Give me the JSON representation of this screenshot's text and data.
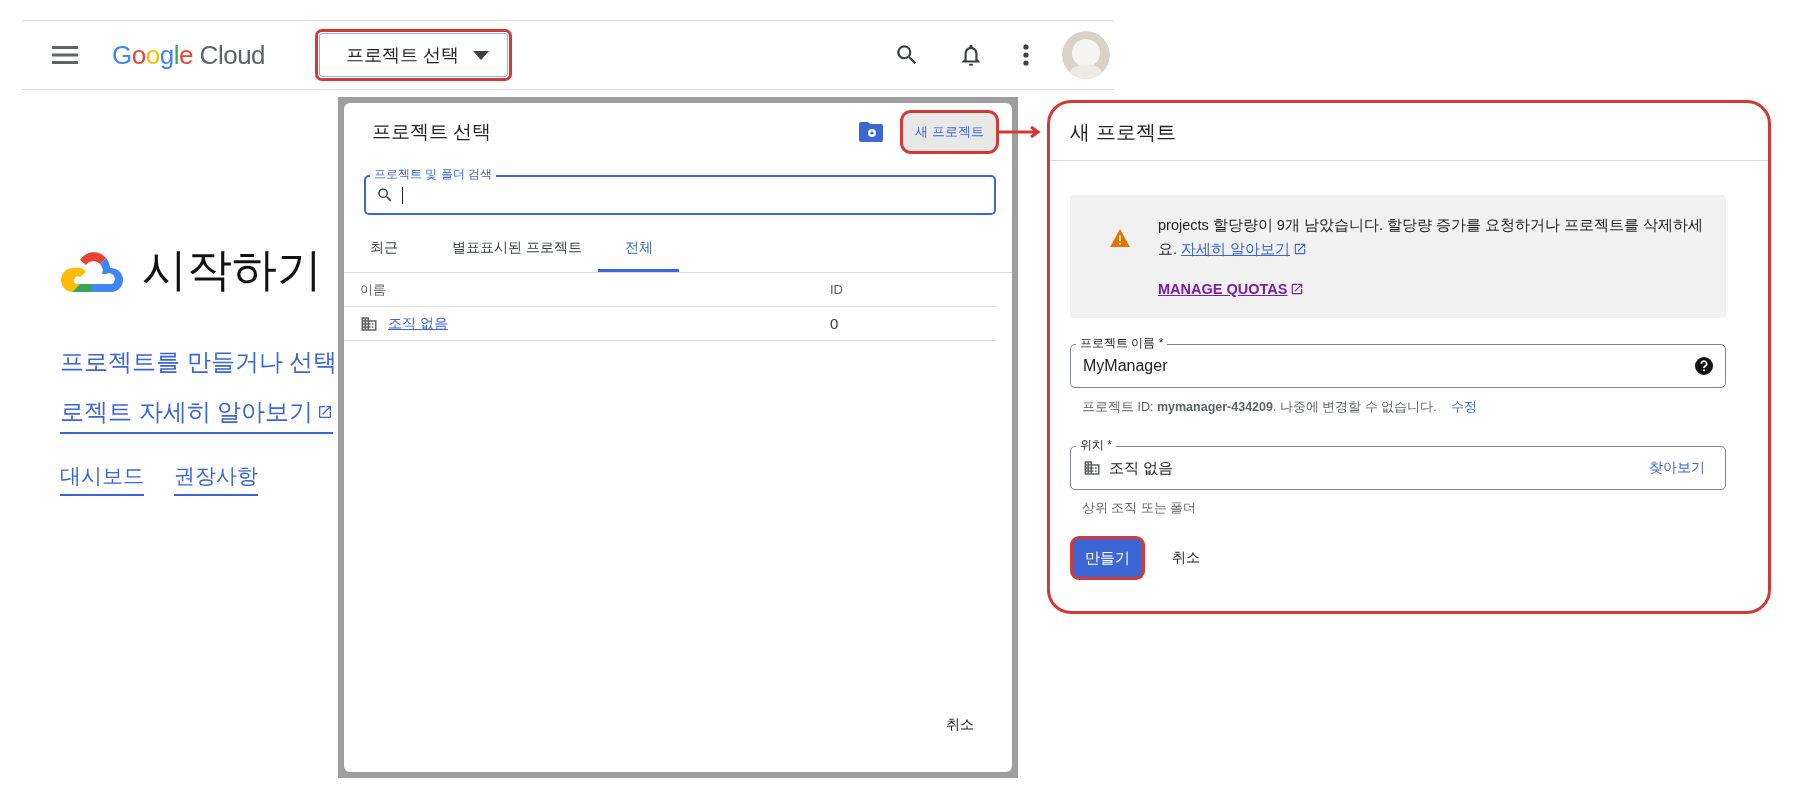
{
  "header": {
    "logo": {
      "brand": "Google",
      "product": "Cloud"
    },
    "project_picker": {
      "label": "프로젝트 선택",
      "highlighted": true
    }
  },
  "page": {
    "title": "시작하기",
    "links": [
      {
        "text": "프로젝트를 만들거나 선택",
        "external": false
      },
      {
        "text": "로젝트 자세히 알아보기",
        "external": true
      }
    ],
    "nav_links": [
      "대시보드",
      "권장사항"
    ]
  },
  "select_dialog": {
    "title": "프로젝트 선택",
    "new_button": {
      "label": "새 프로젝트",
      "highlighted": true
    },
    "search": {
      "label": "프로젝트 및 폴더 검색"
    },
    "tabs": [
      {
        "label": "최근",
        "selected": false
      },
      {
        "label": "별표표시된 프로젝트",
        "selected": false
      },
      {
        "label": "전체",
        "selected": true
      }
    ],
    "columns": [
      "이름",
      "ID"
    ],
    "rows": [
      {
        "name": "조직 없음",
        "id": "0"
      }
    ],
    "cancel": "취소"
  },
  "new_project": {
    "title": "새 프로젝트",
    "highlighted": true,
    "notice": {
      "text": "projects 할당량이 9개 남았습니다. 할당량 증가를 요청하거나 프로젝트를 삭제하세요.",
      "learn_more": "자세히 알아보기",
      "manage": "MANAGE QUOTAS"
    },
    "name_field": {
      "label": "프로젝트 이름 *",
      "value": "MyManager"
    },
    "id_hint": {
      "text": "프로젝트 ID: **mymanager-434209**. 나중에 변경할 수 없습니다.",
      "edit": "수정"
    },
    "location_field": {
      "label": "위치 *",
      "value": "조직 없음",
      "browse": "찾아보기"
    },
    "location_hint": "상위 조직 또는 폴더",
    "buttons": [
      {
        "label": "만들기",
        "kind": "primary",
        "highlighted": true
      },
      {
        "label": "취소",
        "kind": "text",
        "highlighted": false
      }
    ]
  }
}
